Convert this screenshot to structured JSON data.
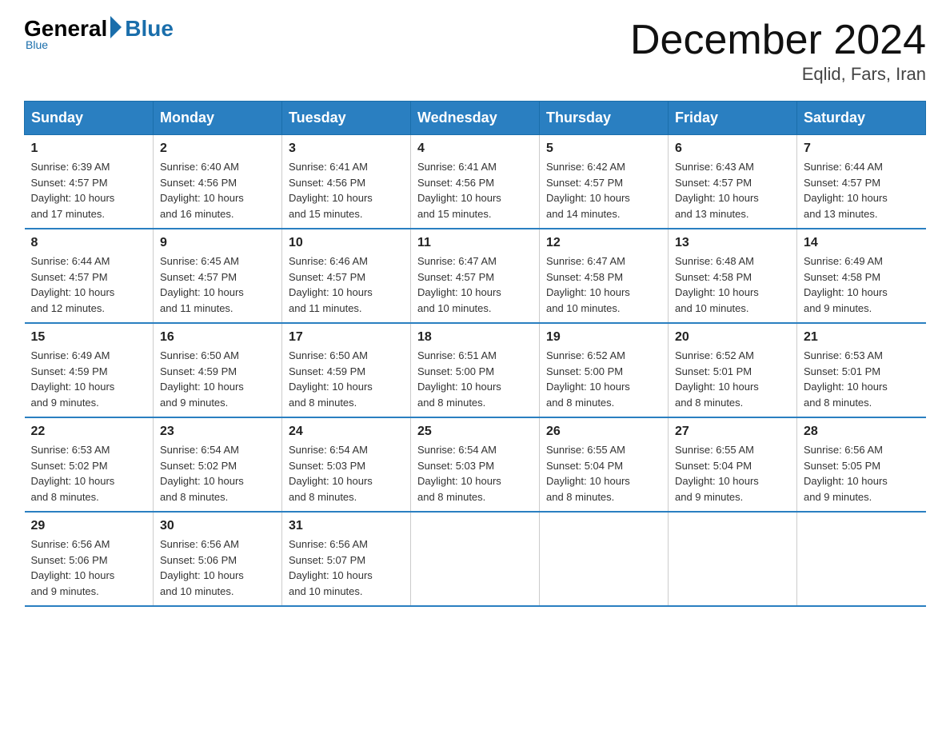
{
  "header": {
    "logo_general": "General",
    "logo_blue": "Blue",
    "logo_subtitle": "Blue",
    "month_title": "December 2024",
    "location": "Eqlid, Fars, Iran"
  },
  "days_of_week": [
    "Sunday",
    "Monday",
    "Tuesday",
    "Wednesday",
    "Thursday",
    "Friday",
    "Saturday"
  ],
  "weeks": [
    [
      {
        "num": "1",
        "info": "Sunrise: 6:39 AM\nSunset: 4:57 PM\nDaylight: 10 hours\nand 17 minutes."
      },
      {
        "num": "2",
        "info": "Sunrise: 6:40 AM\nSunset: 4:56 PM\nDaylight: 10 hours\nand 16 minutes."
      },
      {
        "num": "3",
        "info": "Sunrise: 6:41 AM\nSunset: 4:56 PM\nDaylight: 10 hours\nand 15 minutes."
      },
      {
        "num": "4",
        "info": "Sunrise: 6:41 AM\nSunset: 4:56 PM\nDaylight: 10 hours\nand 15 minutes."
      },
      {
        "num": "5",
        "info": "Sunrise: 6:42 AM\nSunset: 4:57 PM\nDaylight: 10 hours\nand 14 minutes."
      },
      {
        "num": "6",
        "info": "Sunrise: 6:43 AM\nSunset: 4:57 PM\nDaylight: 10 hours\nand 13 minutes."
      },
      {
        "num": "7",
        "info": "Sunrise: 6:44 AM\nSunset: 4:57 PM\nDaylight: 10 hours\nand 13 minutes."
      }
    ],
    [
      {
        "num": "8",
        "info": "Sunrise: 6:44 AM\nSunset: 4:57 PM\nDaylight: 10 hours\nand 12 minutes."
      },
      {
        "num": "9",
        "info": "Sunrise: 6:45 AM\nSunset: 4:57 PM\nDaylight: 10 hours\nand 11 minutes."
      },
      {
        "num": "10",
        "info": "Sunrise: 6:46 AM\nSunset: 4:57 PM\nDaylight: 10 hours\nand 11 minutes."
      },
      {
        "num": "11",
        "info": "Sunrise: 6:47 AM\nSunset: 4:57 PM\nDaylight: 10 hours\nand 10 minutes."
      },
      {
        "num": "12",
        "info": "Sunrise: 6:47 AM\nSunset: 4:58 PM\nDaylight: 10 hours\nand 10 minutes."
      },
      {
        "num": "13",
        "info": "Sunrise: 6:48 AM\nSunset: 4:58 PM\nDaylight: 10 hours\nand 10 minutes."
      },
      {
        "num": "14",
        "info": "Sunrise: 6:49 AM\nSunset: 4:58 PM\nDaylight: 10 hours\nand 9 minutes."
      }
    ],
    [
      {
        "num": "15",
        "info": "Sunrise: 6:49 AM\nSunset: 4:59 PM\nDaylight: 10 hours\nand 9 minutes."
      },
      {
        "num": "16",
        "info": "Sunrise: 6:50 AM\nSunset: 4:59 PM\nDaylight: 10 hours\nand 9 minutes."
      },
      {
        "num": "17",
        "info": "Sunrise: 6:50 AM\nSunset: 4:59 PM\nDaylight: 10 hours\nand 8 minutes."
      },
      {
        "num": "18",
        "info": "Sunrise: 6:51 AM\nSunset: 5:00 PM\nDaylight: 10 hours\nand 8 minutes."
      },
      {
        "num": "19",
        "info": "Sunrise: 6:52 AM\nSunset: 5:00 PM\nDaylight: 10 hours\nand 8 minutes."
      },
      {
        "num": "20",
        "info": "Sunrise: 6:52 AM\nSunset: 5:01 PM\nDaylight: 10 hours\nand 8 minutes."
      },
      {
        "num": "21",
        "info": "Sunrise: 6:53 AM\nSunset: 5:01 PM\nDaylight: 10 hours\nand 8 minutes."
      }
    ],
    [
      {
        "num": "22",
        "info": "Sunrise: 6:53 AM\nSunset: 5:02 PM\nDaylight: 10 hours\nand 8 minutes."
      },
      {
        "num": "23",
        "info": "Sunrise: 6:54 AM\nSunset: 5:02 PM\nDaylight: 10 hours\nand 8 minutes."
      },
      {
        "num": "24",
        "info": "Sunrise: 6:54 AM\nSunset: 5:03 PM\nDaylight: 10 hours\nand 8 minutes."
      },
      {
        "num": "25",
        "info": "Sunrise: 6:54 AM\nSunset: 5:03 PM\nDaylight: 10 hours\nand 8 minutes."
      },
      {
        "num": "26",
        "info": "Sunrise: 6:55 AM\nSunset: 5:04 PM\nDaylight: 10 hours\nand 8 minutes."
      },
      {
        "num": "27",
        "info": "Sunrise: 6:55 AM\nSunset: 5:04 PM\nDaylight: 10 hours\nand 9 minutes."
      },
      {
        "num": "28",
        "info": "Sunrise: 6:56 AM\nSunset: 5:05 PM\nDaylight: 10 hours\nand 9 minutes."
      }
    ],
    [
      {
        "num": "29",
        "info": "Sunrise: 6:56 AM\nSunset: 5:06 PM\nDaylight: 10 hours\nand 9 minutes."
      },
      {
        "num": "30",
        "info": "Sunrise: 6:56 AM\nSunset: 5:06 PM\nDaylight: 10 hours\nand 10 minutes."
      },
      {
        "num": "31",
        "info": "Sunrise: 6:56 AM\nSunset: 5:07 PM\nDaylight: 10 hours\nand 10 minutes."
      },
      {
        "num": "",
        "info": ""
      },
      {
        "num": "",
        "info": ""
      },
      {
        "num": "",
        "info": ""
      },
      {
        "num": "",
        "info": ""
      }
    ]
  ]
}
